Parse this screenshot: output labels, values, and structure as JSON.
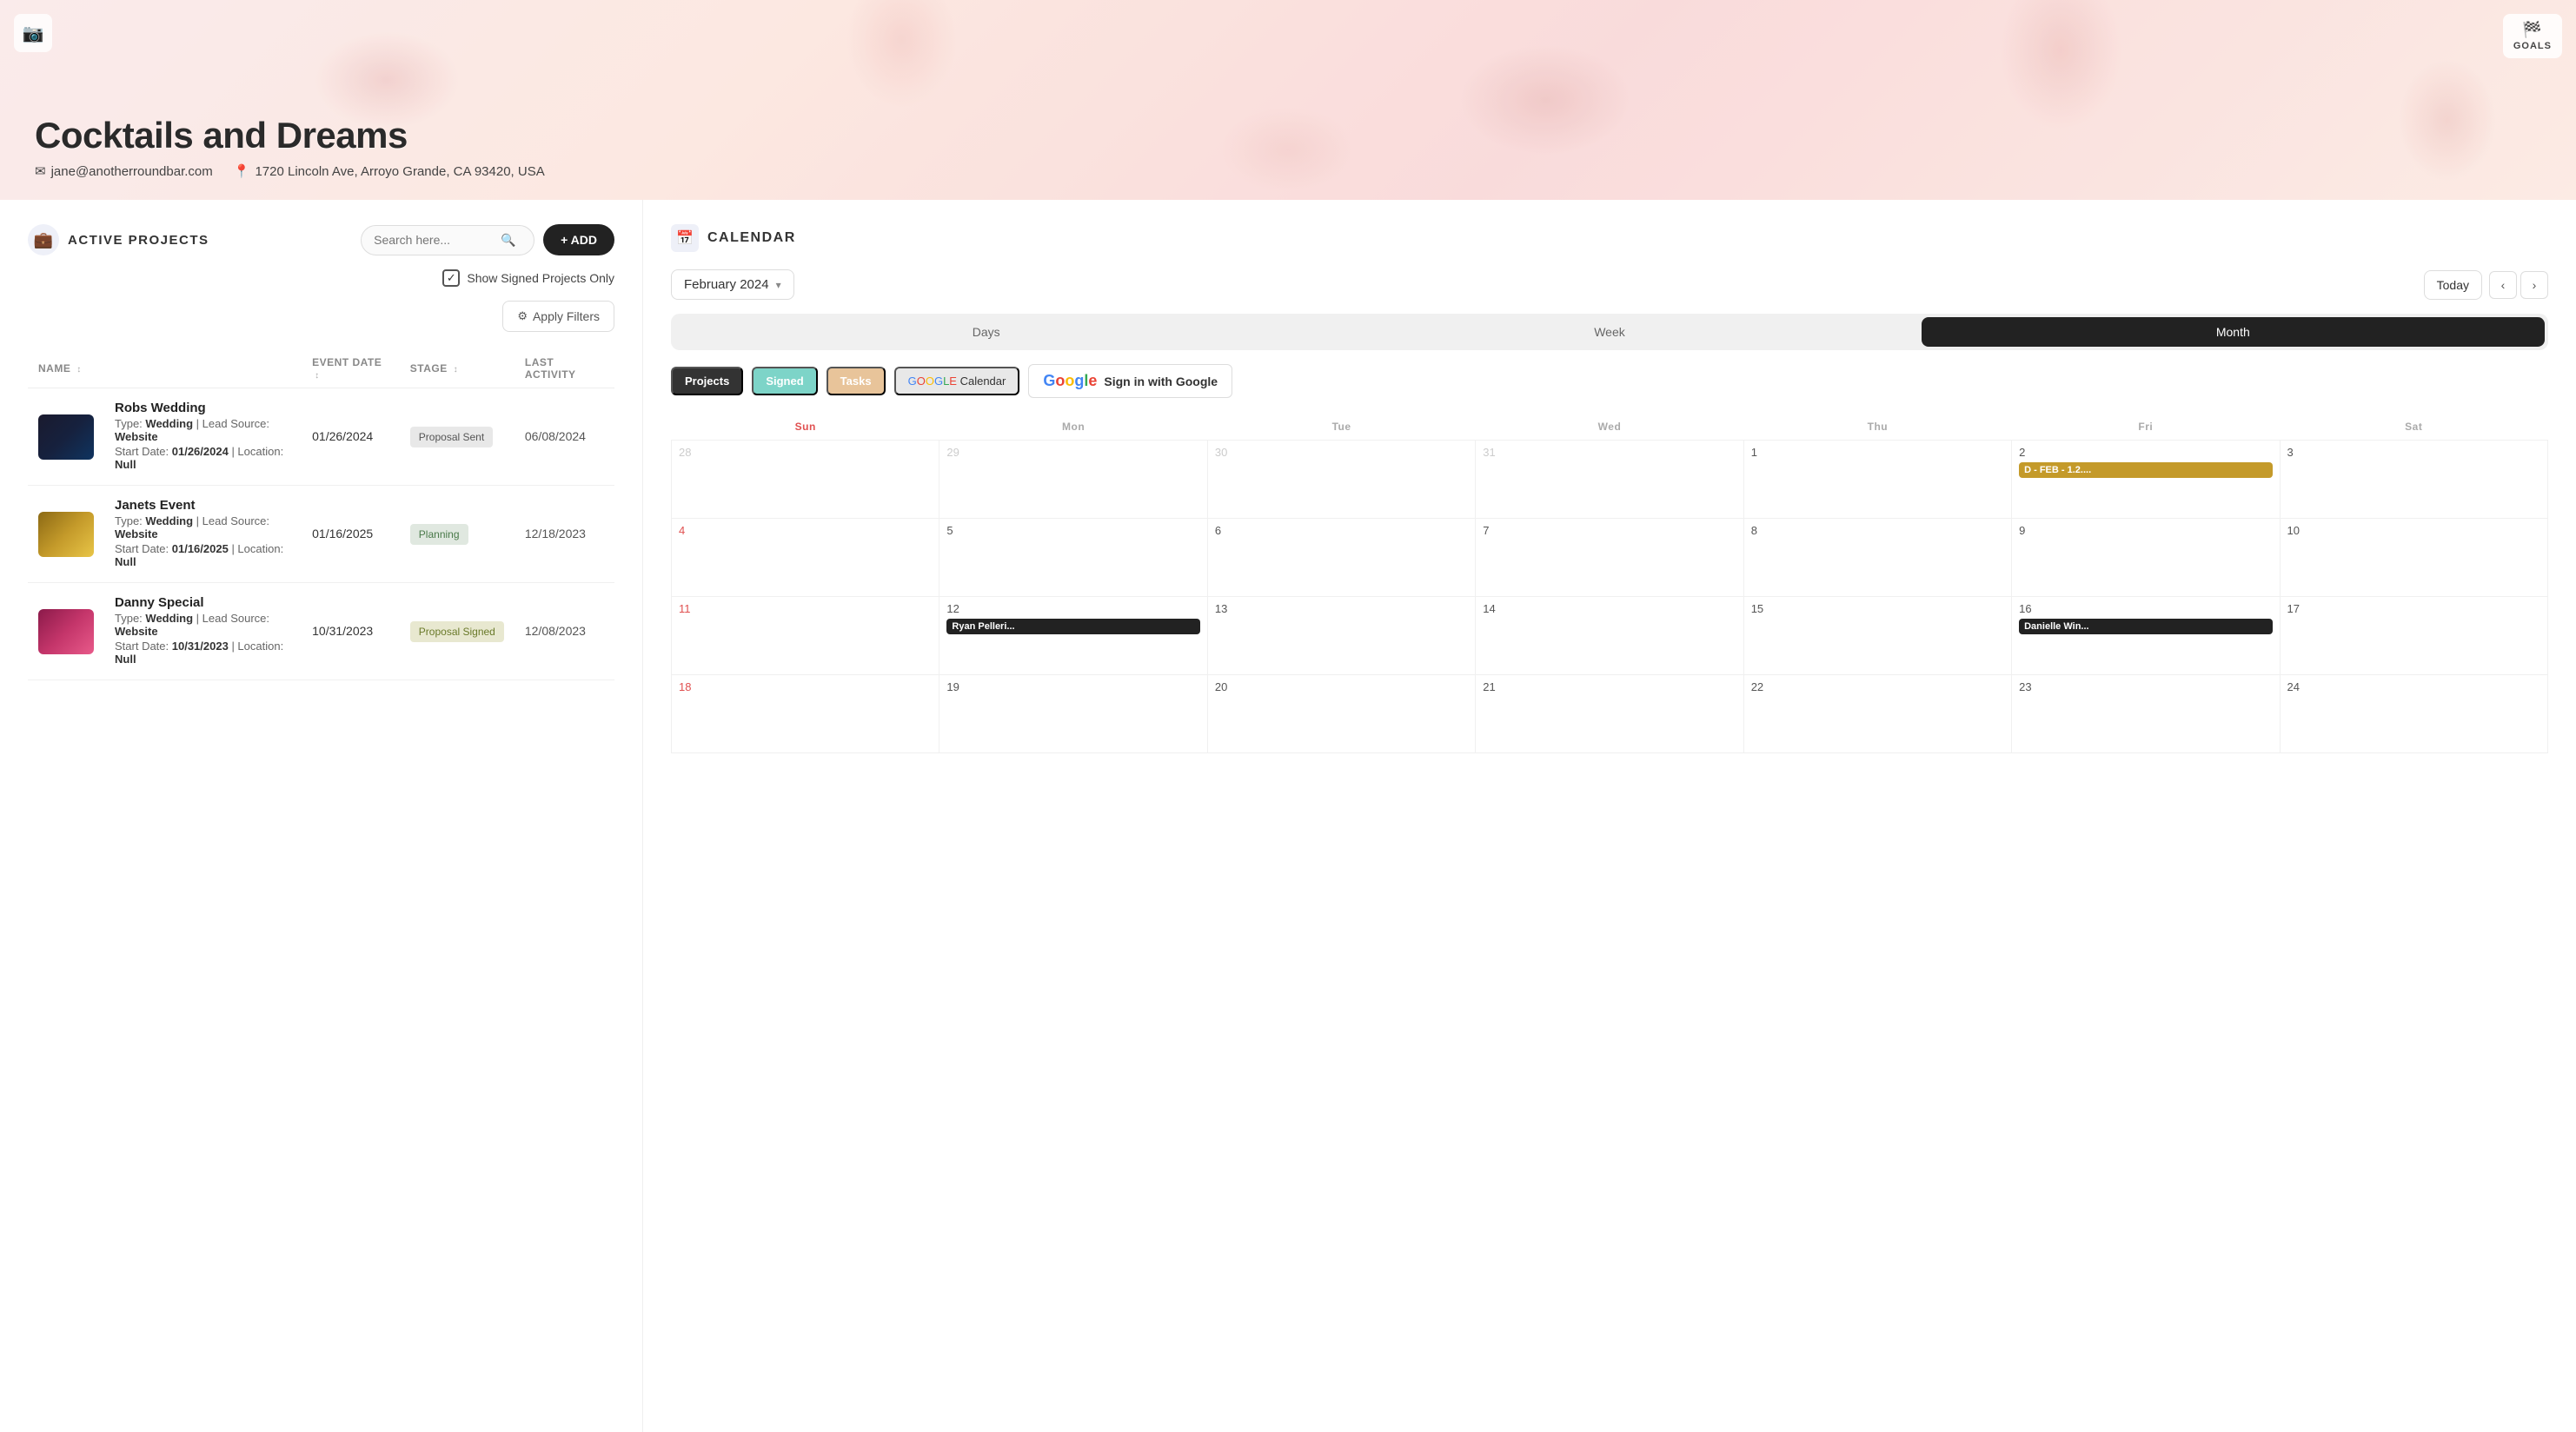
{
  "banner": {
    "title": "Cocktails and Dreams",
    "email": "jane@anotherroundbar.com",
    "address": "1720 Lincoln Ave, Arroyo Grande, CA 93420, USA",
    "camera_label": "📷",
    "goals_label": "GOALS"
  },
  "projects_panel": {
    "title": "ACTIVE PROJECTS",
    "search_placeholder": "Search here...",
    "add_button": "+ ADD",
    "show_signed_label": "Show Signed Projects Only",
    "apply_filters_label": "Apply Filters",
    "columns": {
      "name": "NAME",
      "event_date": "EVENT DATE",
      "stage": "STAGE",
      "last_activity": "LAST ACTIVITY"
    },
    "projects": [
      {
        "id": 1,
        "name": "Robs Wedding",
        "type": "Wedding",
        "lead_source": "Website",
        "start_date": "01/26/2024",
        "location": "Null",
        "event_date": "01/26/2024",
        "stage": "Proposal Sent",
        "stage_class": "proposal-sent",
        "last_activity": "06/08/2024",
        "thumb_class": "thumb-dark"
      },
      {
        "id": 2,
        "name": "Janets Event",
        "type": "Wedding",
        "lead_source": "Website",
        "start_date": "01/16/2025",
        "location": "Null",
        "event_date": "01/16/2025",
        "stage": "Planning",
        "stage_class": "planning",
        "last_activity": "12/18/2023",
        "thumb_class": "thumb-warm"
      },
      {
        "id": 3,
        "name": "Danny Special",
        "type": "Wedding",
        "lead_source": "Website",
        "start_date": "10/31/2023",
        "location": "Null",
        "event_date": "10/31/2023",
        "stage": "Proposal Signed",
        "stage_class": "proposal-signed",
        "last_activity": "12/08/2023",
        "thumb_class": "thumb-floral"
      }
    ]
  },
  "calendar": {
    "title": "CALENDAR",
    "current_month": "February 2024",
    "today_label": "Today",
    "views": [
      "Days",
      "Week",
      "Month"
    ],
    "active_view": "Month",
    "tags": {
      "projects": "Projects",
      "signed": "Signed",
      "tasks": "Tasks",
      "google": "GOOGLE Calendar",
      "sign_in": "Sign in with Google"
    },
    "day_headers": [
      "Sun",
      "Mon",
      "Tue",
      "Wed",
      "Thu",
      "Fri",
      "Sat"
    ],
    "weeks": [
      {
        "days": [
          {
            "num": "28",
            "other": true,
            "events": []
          },
          {
            "num": "29",
            "other": true,
            "events": []
          },
          {
            "num": "30",
            "other": true,
            "events": []
          },
          {
            "num": "31",
            "other": true,
            "events": []
          },
          {
            "num": "1",
            "other": false,
            "events": []
          },
          {
            "num": "2",
            "other": false,
            "events": [
              {
                "label": "D - FEB - 1.2....",
                "type": "gold"
              }
            ]
          },
          {
            "num": "3",
            "other": false,
            "events": []
          }
        ]
      },
      {
        "days": [
          {
            "num": "4",
            "other": false,
            "sun": true,
            "events": []
          },
          {
            "num": "5",
            "other": false,
            "events": []
          },
          {
            "num": "6",
            "other": false,
            "events": []
          },
          {
            "num": "7",
            "other": false,
            "events": []
          },
          {
            "num": "8",
            "other": false,
            "events": []
          },
          {
            "num": "9",
            "other": false,
            "events": []
          },
          {
            "num": "10",
            "other": false,
            "events": []
          }
        ]
      },
      {
        "days": [
          {
            "num": "11",
            "other": false,
            "sun": true,
            "events": []
          },
          {
            "num": "12",
            "other": false,
            "events": [
              {
                "label": "Ryan Pelleri...",
                "type": "dark"
              }
            ]
          },
          {
            "num": "13",
            "other": false,
            "events": []
          },
          {
            "num": "14",
            "other": false,
            "events": []
          },
          {
            "num": "15",
            "other": false,
            "events": []
          },
          {
            "num": "16",
            "other": false,
            "events": [
              {
                "label": "Danielle Win...",
                "type": "dark"
              }
            ]
          },
          {
            "num": "17",
            "other": false,
            "events": []
          }
        ]
      },
      {
        "days": [
          {
            "num": "18",
            "other": false,
            "sun": true,
            "events": []
          },
          {
            "num": "19",
            "other": false,
            "events": []
          },
          {
            "num": "20",
            "other": false,
            "events": []
          },
          {
            "num": "21",
            "other": false,
            "events": []
          },
          {
            "num": "22",
            "other": false,
            "events": []
          },
          {
            "num": "23",
            "other": false,
            "events": []
          },
          {
            "num": "24",
            "other": false,
            "events": []
          }
        ]
      }
    ]
  }
}
